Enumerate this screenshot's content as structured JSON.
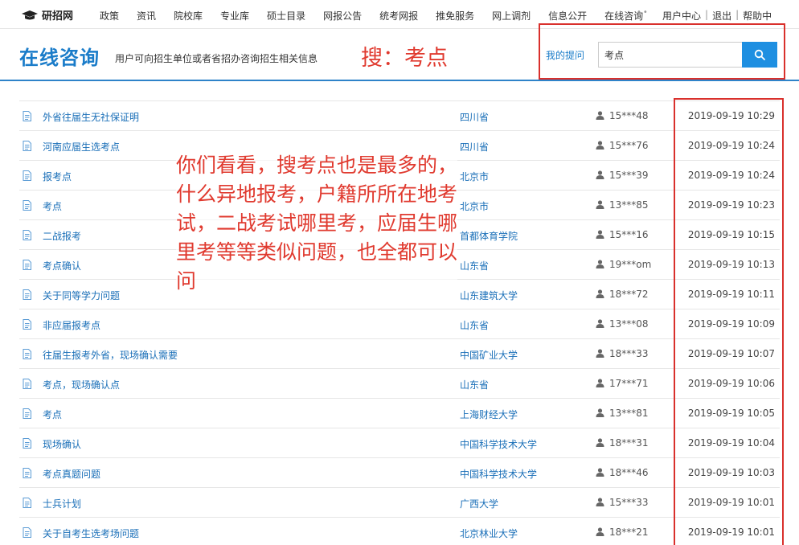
{
  "nav": {
    "logo_text": "研招网",
    "items": [
      "政策",
      "资讯",
      "院校库",
      "专业库",
      "硕士目录",
      "网报公告",
      "统考网报",
      "推免服务",
      "网上调剂",
      "信息公开",
      "在线咨询"
    ],
    "more": "••",
    "user_center": "用户中心",
    "logout": "退出",
    "help": "帮助中"
  },
  "header": {
    "title": "在线咨询",
    "subtitle": "用户可向招生单位或者省招办咨询招生相关信息",
    "my_questions": "我的提问",
    "search_value": "考点"
  },
  "annotations": {
    "search_note": "搜：考点",
    "body_note": "你们看看，搜考点也是最多的，什么异地报考，户籍所所在地考试，二战考试哪里考，应届生哪里考等等类似问题，也全都可以问"
  },
  "rows": [
    {
      "question": "外省往届生无社保证明",
      "school": "四川省",
      "user": "15***48",
      "time": "2019-09-19 10:29"
    },
    {
      "question": "河南应届生选考点",
      "school": "四川省",
      "user": "15***76",
      "time": "2019-09-19 10:24"
    },
    {
      "question": "报考点",
      "school": "北京市",
      "user": "15***39",
      "time": "2019-09-19 10:24"
    },
    {
      "question": "考点",
      "school": "北京市",
      "user": "13***85",
      "time": "2019-09-19 10:23"
    },
    {
      "question": "二战报考",
      "school": "首都体育学院",
      "user": "15***16",
      "time": "2019-09-19 10:15"
    },
    {
      "question": "考点确认",
      "school": "山东省",
      "user": "19***om",
      "time": "2019-09-19 10:13"
    },
    {
      "question": "关于同等学力问题",
      "school": "山东建筑大学",
      "user": "18***72",
      "time": "2019-09-19 10:11"
    },
    {
      "question": "非应届报考点",
      "school": "山东省",
      "user": "13***08",
      "time": "2019-09-19 10:09"
    },
    {
      "question": "往届生报考外省，现场确认需要",
      "school": "中国矿业大学",
      "user": "18***33",
      "time": "2019-09-19 10:07"
    },
    {
      "question": "考点，现场确认点",
      "school": "山东省",
      "user": "17***71",
      "time": "2019-09-19 10:06"
    },
    {
      "question": "考点",
      "school": "上海财经大学",
      "user": "13***81",
      "time": "2019-09-19 10:05"
    },
    {
      "question": "现场确认",
      "school": "中国科学技术大学",
      "user": "18***31",
      "time": "2019-09-19 10:04"
    },
    {
      "question": "考点真题问题",
      "school": "中国科学技术大学",
      "user": "18***46",
      "time": "2019-09-19 10:03"
    },
    {
      "question": "士兵计划",
      "school": "广西大学",
      "user": "15***33",
      "time": "2019-09-19 10:01"
    },
    {
      "question": "关于自考生选考场问题",
      "school": "北京林业大学",
      "user": "18***21",
      "time": "2019-09-19 10:01"
    }
  ]
}
